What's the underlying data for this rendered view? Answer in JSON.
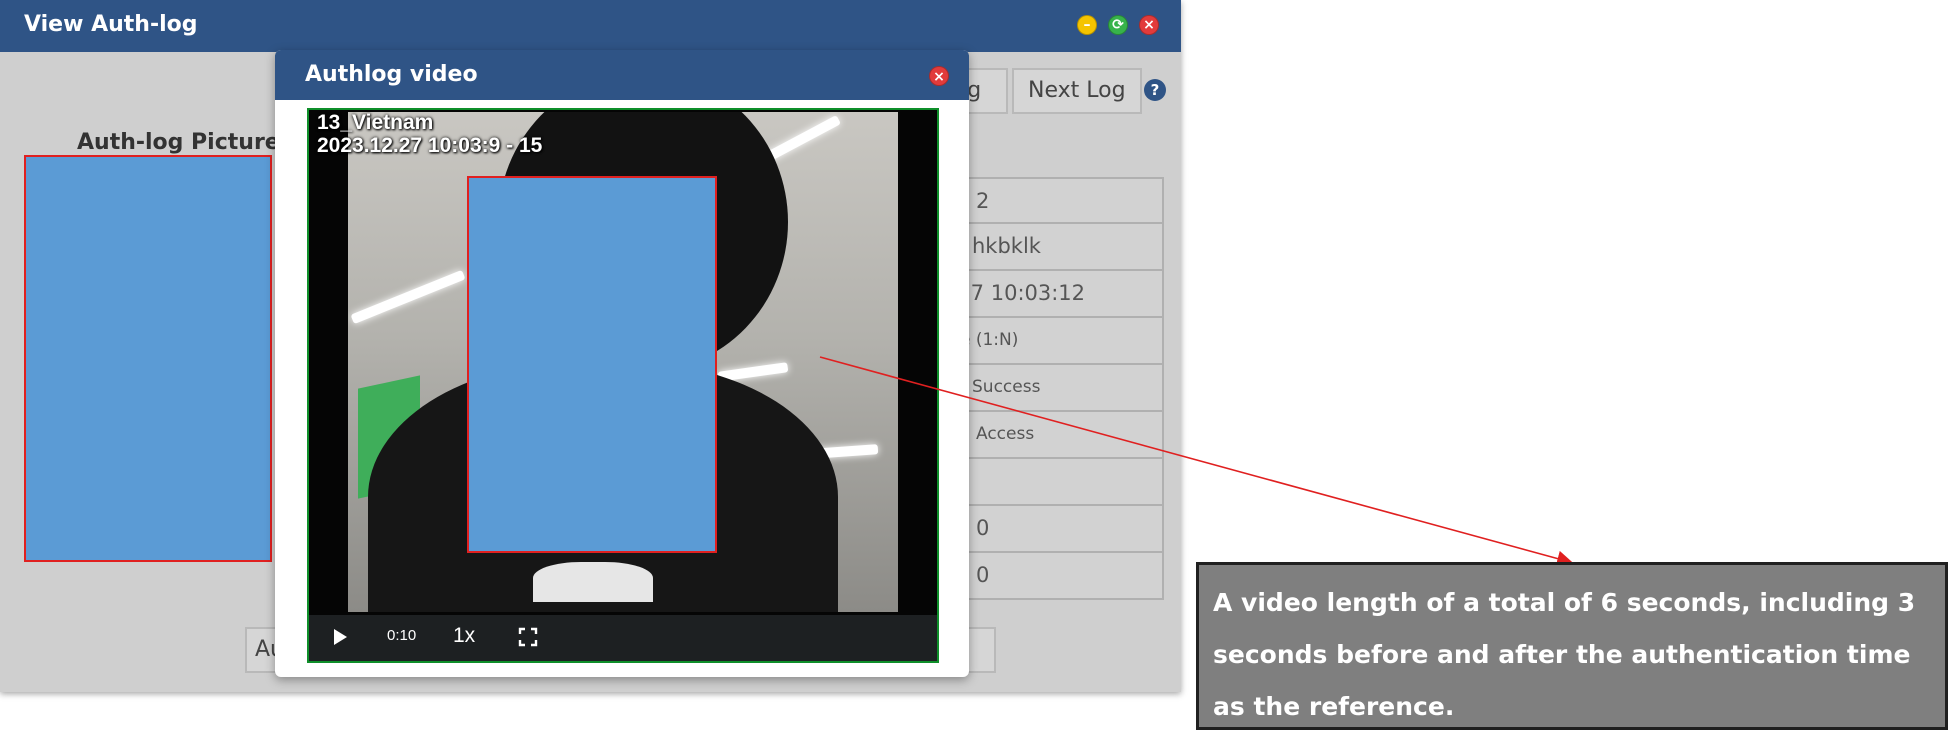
{
  "window": {
    "title": "View Auth-log",
    "prev_button": "Previous Log",
    "next_button": "Next Log",
    "help_icon": "?",
    "picture_label": "Auth-log Picture",
    "info_rows": [
      "2",
      "hkbklk",
      "2023-12-27 10:03:12",
      "Face (1:N)",
      "Success",
      "Access",
      "",
      "0",
      "0"
    ],
    "bottom_left_button": "Au",
    "bottom_right_button": ""
  },
  "dialog": {
    "title": "Authlog video",
    "video": {
      "overlay_line1": "13_Vietnam",
      "overlay_line2": "2023.12.27 10:03:9 - 15",
      "time": "0:10",
      "speed": "1x"
    }
  },
  "annotation": {
    "text": "A video length of a total of 6 seconds, including 3 seconds before and after the authentication time as the reference."
  },
  "colors": {
    "titlebar": "#2f5486",
    "redaction": "#5b9bd5",
    "redaction_border": "#e02020",
    "video_border": "#0f8f2a",
    "annotation_bg": "#7f7f7f"
  },
  "icons": [
    "minimize-icon",
    "maximize-icon",
    "close-icon",
    "help-icon",
    "play-icon",
    "fullscreen-icon"
  ]
}
